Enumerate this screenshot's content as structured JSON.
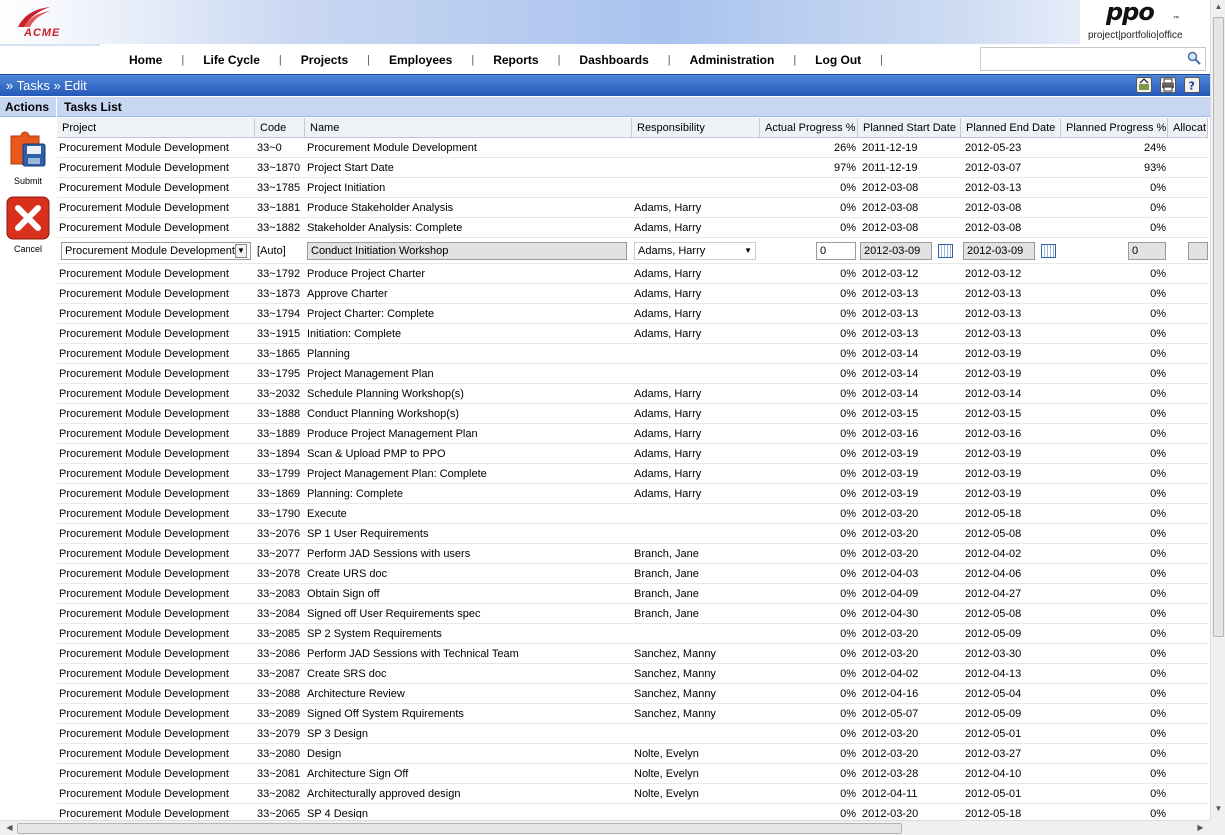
{
  "brand": {
    "acme": "ACME",
    "ppo": "ppo",
    "ppo_tm": "™",
    "ppo_tagline": "project|portfolio|office"
  },
  "nav": [
    "Home",
    "Life Cycle",
    "Projects",
    "Employees",
    "Reports",
    "Dashboards",
    "Administration",
    "Log Out"
  ],
  "search": {
    "placeholder": ""
  },
  "titlebar": {
    "title": "» Tasks » Edit"
  },
  "subhead": {
    "actions": "Actions",
    "tasks_list": "Tasks List"
  },
  "actions": {
    "submit": "Submit",
    "cancel": "Cancel"
  },
  "columns": [
    "Project",
    "Code",
    "Name",
    "Responsibility",
    "Actual Progress %",
    "Planned Start Date",
    "Planned End Date",
    "Planned Progress %",
    "Allocat"
  ],
  "edit_row": {
    "project": "Procurement Module Development",
    "code": "[Auto]",
    "name": "Conduct Initiation Workshop",
    "responsibility": "Adams, Harry",
    "actual": "0",
    "start": "2012-03-09",
    "end": "2012-03-09",
    "planned": "0"
  },
  "rows_before": [
    {
      "project": "Procurement Module Development",
      "code": "33~0",
      "name": "Procurement Module Development",
      "resp": "",
      "actual": "26%",
      "start": "2011-12-19",
      "end": "2012-05-23",
      "planned": "24%"
    },
    {
      "project": "Procurement Module Development",
      "code": "33~1870",
      "name": "Project Start Date",
      "resp": "",
      "actual": "97%",
      "start": "2011-12-19",
      "end": "2012-03-07",
      "planned": "93%"
    },
    {
      "project": "Procurement Module Development",
      "code": "33~1785",
      "name": "Project Initiation",
      "resp": "",
      "actual": "0%",
      "start": "2012-03-08",
      "end": "2012-03-13",
      "planned": "0%"
    },
    {
      "project": "Procurement Module Development",
      "code": "33~1881",
      "name": "Produce Stakeholder Analysis",
      "resp": "Adams, Harry",
      "actual": "0%",
      "start": "2012-03-08",
      "end": "2012-03-08",
      "planned": "0%"
    },
    {
      "project": "Procurement Module Development",
      "code": "33~1882",
      "name": "Stakeholder Analysis: Complete",
      "resp": "Adams, Harry",
      "actual": "0%",
      "start": "2012-03-08",
      "end": "2012-03-08",
      "planned": "0%"
    }
  ],
  "rows_after": [
    {
      "project": "Procurement Module Development",
      "code": "33~1792",
      "name": "Produce Project Charter",
      "resp": "Adams, Harry",
      "actual": "0%",
      "start": "2012-03-12",
      "end": "2012-03-12",
      "planned": "0%"
    },
    {
      "project": "Procurement Module Development",
      "code": "33~1873",
      "name": "Approve Charter",
      "resp": "Adams, Harry",
      "actual": "0%",
      "start": "2012-03-13",
      "end": "2012-03-13",
      "planned": "0%"
    },
    {
      "project": "Procurement Module Development",
      "code": "33~1794",
      "name": "Project Charter: Complete",
      "resp": "Adams, Harry",
      "actual": "0%",
      "start": "2012-03-13",
      "end": "2012-03-13",
      "planned": "0%"
    },
    {
      "project": "Procurement Module Development",
      "code": "33~1915",
      "name": "Initiation: Complete",
      "resp": "Adams, Harry",
      "actual": "0%",
      "start": "2012-03-13",
      "end": "2012-03-13",
      "planned": "0%"
    },
    {
      "project": "Procurement Module Development",
      "code": "33~1865",
      "name": "Planning",
      "resp": "",
      "actual": "0%",
      "start": "2012-03-14",
      "end": "2012-03-19",
      "planned": "0%"
    },
    {
      "project": "Procurement Module Development",
      "code": "33~1795",
      "name": "Project Management Plan",
      "resp": "",
      "actual": "0%",
      "start": "2012-03-14",
      "end": "2012-03-19",
      "planned": "0%"
    },
    {
      "project": "Procurement Module Development",
      "code": "33~2032",
      "name": "Schedule Planning Workshop(s)",
      "resp": "Adams, Harry",
      "actual": "0%",
      "start": "2012-03-14",
      "end": "2012-03-14",
      "planned": "0%"
    },
    {
      "project": "Procurement Module Development",
      "code": "33~1888",
      "name": "Conduct Planning Workshop(s)",
      "resp": "Adams, Harry",
      "actual": "0%",
      "start": "2012-03-15",
      "end": "2012-03-15",
      "planned": "0%"
    },
    {
      "project": "Procurement Module Development",
      "code": "33~1889",
      "name": "Produce Project Management Plan",
      "resp": "Adams, Harry",
      "actual": "0%",
      "start": "2012-03-16",
      "end": "2012-03-16",
      "planned": "0%"
    },
    {
      "project": "Procurement Module Development",
      "code": "33~1894",
      "name": "Scan & Upload PMP to PPO",
      "resp": "Adams, Harry",
      "actual": "0%",
      "start": "2012-03-19",
      "end": "2012-03-19",
      "planned": "0%"
    },
    {
      "project": "Procurement Module Development",
      "code": "33~1799",
      "name": "Project Management Plan: Complete",
      "resp": "Adams, Harry",
      "actual": "0%",
      "start": "2012-03-19",
      "end": "2012-03-19",
      "planned": "0%"
    },
    {
      "project": "Procurement Module Development",
      "code": "33~1869",
      "name": "Planning: Complete",
      "resp": "Adams, Harry",
      "actual": "0%",
      "start": "2012-03-19",
      "end": "2012-03-19",
      "planned": "0%"
    },
    {
      "project": "Procurement Module Development",
      "code": "33~1790",
      "name": "Execute",
      "resp": "",
      "actual": "0%",
      "start": "2012-03-20",
      "end": "2012-05-18",
      "planned": "0%"
    },
    {
      "project": "Procurement Module Development",
      "code": "33~2076",
      "name": "SP 1 User Requirements",
      "resp": "",
      "actual": "0%",
      "start": "2012-03-20",
      "end": "2012-05-08",
      "planned": "0%"
    },
    {
      "project": "Procurement Module Development",
      "code": "33~2077",
      "name": "Perform JAD Sessions with users",
      "resp": "Branch, Jane",
      "actual": "0%",
      "start": "2012-03-20",
      "end": "2012-04-02",
      "planned": "0%"
    },
    {
      "project": "Procurement Module Development",
      "code": "33~2078",
      "name": "Create URS doc",
      "resp": "Branch, Jane",
      "actual": "0%",
      "start": "2012-04-03",
      "end": "2012-04-06",
      "planned": "0%"
    },
    {
      "project": "Procurement Module Development",
      "code": "33~2083",
      "name": "Obtain Sign off",
      "resp": "Branch, Jane",
      "actual": "0%",
      "start": "2012-04-09",
      "end": "2012-04-27",
      "planned": "0%"
    },
    {
      "project": "Procurement Module Development",
      "code": "33~2084",
      "name": "Signed off User Requirements spec",
      "resp": "Branch, Jane",
      "actual": "0%",
      "start": "2012-04-30",
      "end": "2012-05-08",
      "planned": "0%"
    },
    {
      "project": "Procurement Module Development",
      "code": "33~2085",
      "name": "SP 2 System Requirements",
      "resp": "",
      "actual": "0%",
      "start": "2012-03-20",
      "end": "2012-05-09",
      "planned": "0%"
    },
    {
      "project": "Procurement Module Development",
      "code": "33~2086",
      "name": "Perform JAD Sessions with Technical Team",
      "resp": "Sanchez, Manny",
      "actual": "0%",
      "start": "2012-03-20",
      "end": "2012-03-30",
      "planned": "0%"
    },
    {
      "project": "Procurement Module Development",
      "code": "33~2087",
      "name": "Create SRS doc",
      "resp": "Sanchez, Manny",
      "actual": "0%",
      "start": "2012-04-02",
      "end": "2012-04-13",
      "planned": "0%"
    },
    {
      "project": "Procurement Module Development",
      "code": "33~2088",
      "name": "Architecture Review",
      "resp": "Sanchez, Manny",
      "actual": "0%",
      "start": "2012-04-16",
      "end": "2012-05-04",
      "planned": "0%"
    },
    {
      "project": "Procurement Module Development",
      "code": "33~2089",
      "name": "Signed Off System Rquirements",
      "resp": "Sanchez, Manny",
      "actual": "0%",
      "start": "2012-05-07",
      "end": "2012-05-09",
      "planned": "0%"
    },
    {
      "project": "Procurement Module Development",
      "code": "33~2079",
      "name": "SP 3 Design",
      "resp": "",
      "actual": "0%",
      "start": "2012-03-20",
      "end": "2012-05-01",
      "planned": "0%"
    },
    {
      "project": "Procurement Module Development",
      "code": "33~2080",
      "name": "Design",
      "resp": "Nolte, Evelyn",
      "actual": "0%",
      "start": "2012-03-20",
      "end": "2012-03-27",
      "planned": "0%"
    },
    {
      "project": "Procurement Module Development",
      "code": "33~2081",
      "name": "Architecture Sign Off",
      "resp": "Nolte, Evelyn",
      "actual": "0%",
      "start": "2012-03-28",
      "end": "2012-04-10",
      "planned": "0%"
    },
    {
      "project": "Procurement Module Development",
      "code": "33~2082",
      "name": "Architecturally approved design",
      "resp": "Nolte, Evelyn",
      "actual": "0%",
      "start": "2012-04-11",
      "end": "2012-05-01",
      "planned": "0%"
    },
    {
      "project": "Procurement Module Development",
      "code": "33~2065",
      "name": "SP 4 Design",
      "resp": "",
      "actual": "0%",
      "start": "2012-03-20",
      "end": "2012-05-18",
      "planned": "0%"
    }
  ]
}
